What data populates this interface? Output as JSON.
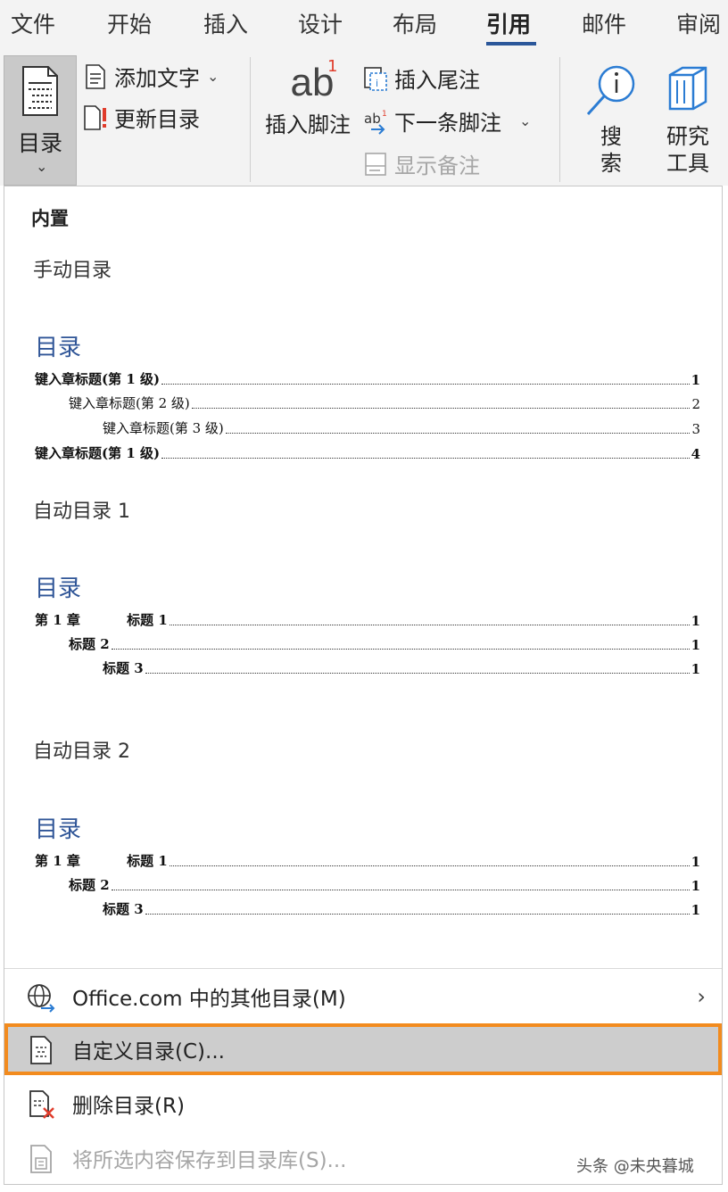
{
  "tabs": [
    "文件",
    "开始",
    "插入",
    "设计",
    "布局",
    "引用",
    "邮件",
    "审阅"
  ],
  "active_tab": "引用",
  "ribbon": {
    "toc_label": "目录",
    "add_text": "添加文字",
    "update_toc": "更新目录",
    "insert_footnote": "插入脚注",
    "insert_endnote": "插入尾注",
    "next_footnote": "下一条脚注",
    "show_notes": "显示备注",
    "search_top": "搜",
    "search_bottom": "索",
    "research_top": "研究",
    "research_bottom": "工具",
    "footnote_icon_text": "ab",
    "footnote_icon_sup": "1"
  },
  "panel": {
    "section_heading": "内置",
    "galleries": [
      {
        "title": "手动目录",
        "toc_heading": "目录",
        "lines": [
          {
            "text": "键入章标题(第 1 级)",
            "page": "1"
          },
          {
            "text": "键入章标题(第 2 级)",
            "page": "2"
          },
          {
            "text": "键入章标题(第 3 级)",
            "page": "3"
          },
          {
            "text": "键入章标题(第 1 级)",
            "page": "4"
          }
        ]
      },
      {
        "title": "自动目录 1",
        "toc_heading": "目录",
        "lines": [
          {
            "text": "第 1 章          标题 1",
            "page": "1"
          },
          {
            "text": "标题 2",
            "page": "1"
          },
          {
            "text": "标题 3",
            "page": "1"
          }
        ]
      },
      {
        "title": "自动目录 2",
        "toc_heading": "目录",
        "lines": [
          {
            "text": "第 1 章          标题 1",
            "page": "1"
          },
          {
            "text": "标题 2",
            "page": "1"
          },
          {
            "text": "标题 3",
            "page": "1"
          }
        ]
      }
    ],
    "menu": {
      "more_office": "Office.com 中的其他目录(M)",
      "custom_toc": "自定义目录(C)...",
      "remove_toc": "删除目录(R)",
      "save_selection": "将所选内容保存到目录库(S)..."
    }
  },
  "watermark": "头条 @未央暮城",
  "colors": {
    "accent": "#2b579a",
    "toc_heading": "#2f5597",
    "highlight_border": "#f28b1e",
    "highlight_bg": "#cdcdcd"
  }
}
